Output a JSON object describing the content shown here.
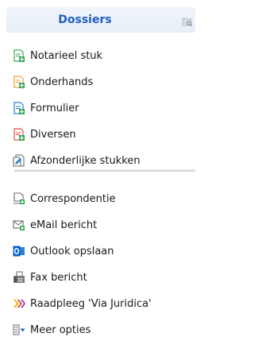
{
  "header": {
    "title": "Dossiers",
    "icon": "folder-search-icon"
  },
  "items_top": [
    {
      "label": "Notarieel stuk",
      "icon": "document-add-green-icon"
    },
    {
      "label": "Onderhands",
      "icon": "document-add-orange-icon"
    },
    {
      "label": "Formulier",
      "icon": "document-add-blue-icon"
    },
    {
      "label": "Diversen",
      "icon": "document-add-red-icon"
    },
    {
      "label": "Afzonderlijke stukken",
      "icon": "document-edit-icon"
    }
  ],
  "items_bottom": [
    {
      "label": "Correspondentie",
      "icon": "letter-add-icon"
    },
    {
      "label": "eMail bericht",
      "icon": "email-add-icon"
    },
    {
      "label": "Outlook opslaan",
      "icon": "outlook-icon"
    },
    {
      "label": "Fax bericht",
      "icon": "fax-icon"
    },
    {
      "label": "Raadpleeg 'Via Juridica'",
      "icon": "via-juridica-icon"
    },
    {
      "label": "Meer opties",
      "icon": "more-options-icon"
    }
  ],
  "colors": {
    "header_text": "#1f5fbf",
    "green": "#3aa655",
    "orange": "#f0a030",
    "blue": "#2f7fd6",
    "red": "#e0504a",
    "outlook_blue": "#0a64c8"
  }
}
